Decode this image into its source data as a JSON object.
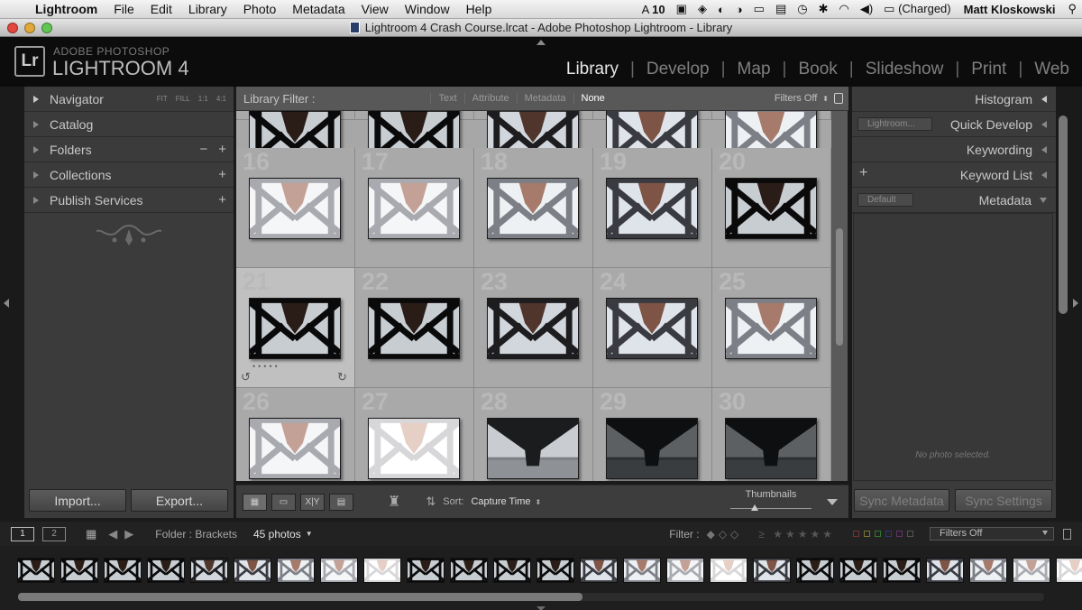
{
  "menubar": {
    "app": "Lightroom",
    "items": [
      "File",
      "Edit",
      "Library",
      "Photo",
      "Metadata",
      "View",
      "Window",
      "Help"
    ],
    "status_adobe": "10",
    "battery": "(Charged)",
    "user": "Matt Kloskowski"
  },
  "window": {
    "title": "Lightroom 4 Crash Course.lrcat - Adobe Photoshop Lightroom - Library"
  },
  "identity": {
    "logo": "Lr",
    "small": "ADOBE PHOTOSHOP",
    "big": "LIGHTROOM 4"
  },
  "modules": [
    "Library",
    "Develop",
    "Map",
    "Book",
    "Slideshow",
    "Print",
    "Web"
  ],
  "left_panel": {
    "navigator": "Navigator",
    "nav_options": [
      "FIT",
      "FILL",
      "1:1",
      "4:1"
    ],
    "catalog": "Catalog",
    "folders": "Folders",
    "collections": "Collections",
    "publish": "Publish Services",
    "import_btn": "Import...",
    "export_btn": "Export..."
  },
  "filter_bar": {
    "title": "Library Filter :",
    "items": [
      "Text",
      "Attribute",
      "Metadata",
      "None"
    ],
    "active": "None",
    "preset": "Filters Off"
  },
  "grid": {
    "cells": [
      {
        "n": "16",
        "style": "overexposed"
      },
      {
        "n": "17",
        "style": "overexposed"
      },
      {
        "n": "18",
        "style": "bright"
      },
      {
        "n": "19",
        "style": "normal"
      },
      {
        "n": "20",
        "style": "dark"
      },
      {
        "n": "21",
        "style": "dark"
      },
      {
        "n": "22",
        "style": "dark"
      },
      {
        "n": "23",
        "style": "darkish"
      },
      {
        "n": "24",
        "style": "normal"
      },
      {
        "n": "25",
        "style": "bright"
      },
      {
        "n": "26",
        "style": "overexposed"
      },
      {
        "n": "27",
        "style": "blown"
      },
      {
        "n": "28",
        "style": "bridge-day"
      },
      {
        "n": "29",
        "style": "bridge-dusk"
      },
      {
        "n": "30",
        "style": "bridge-dusk"
      }
    ],
    "selected_index": "21"
  },
  "toolbar": {
    "sort_label": "Sort:",
    "sort_value": "Capture Time",
    "thumbnails_label": "Thumbnails",
    "thumbnail_size": 0.25
  },
  "right_panel": {
    "histogram": "Histogram",
    "quick_develop": "Quick Develop",
    "qd_preset": "Lightroom...",
    "keywording": "Keywording",
    "keyword_list": "Keyword List",
    "metadata": "Metadata",
    "metadata_preset": "Default",
    "no_photo": "No photo selected.",
    "sync_metadata": "Sync Metadata",
    "sync_settings": "Sync Settings"
  },
  "filmstrip_header": {
    "screen1": "1",
    "screen2": "2",
    "folder": "Folder : Brackets",
    "count": "45 photos",
    "filter_label": "Filter :",
    "filter_value": "Filters Off"
  },
  "filmstrip": {
    "styles": [
      "dark",
      "dark",
      "dark",
      "dark",
      "darkish",
      "normal",
      "bright",
      "overexposed",
      "blown",
      "dark",
      "dark",
      "dark",
      "dark",
      "normal",
      "bright",
      "overexposed",
      "blown",
      "normal",
      "dark",
      "dark",
      "dark",
      "normal",
      "bright",
      "overexposed",
      "blown"
    ],
    "scroll_fraction": 0.55
  },
  "colors": {
    "accent_active": "#e6e6e6",
    "panel_bg": "#3b3b3b",
    "grid_bg": "#a9a9a9"
  }
}
